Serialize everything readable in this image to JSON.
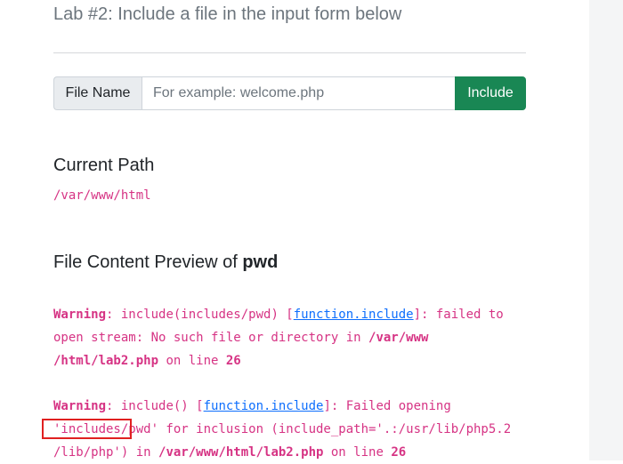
{
  "page": {
    "title": "Lab #2: Include a file in the input form below"
  },
  "form": {
    "addon_label": "File Name",
    "placeholder": "For example: welcome.php",
    "value": "",
    "button_label": "Include"
  },
  "current_path": {
    "heading": "Current Path",
    "value": "/var/www/html"
  },
  "preview": {
    "heading_prefix": "File Content Preview of ",
    "filename": "pwd"
  },
  "warning1": {
    "label": "Warning",
    "text_a": ": include(includes/pwd) [",
    "link": "function.include",
    "text_b": "]: failed to",
    "line2_a": "open stream: No such file or directory in ",
    "path1": "/var/www",
    "path2": "/html/lab2.php",
    "on_line": " on line ",
    "line_no": "26"
  },
  "warning2": {
    "label": "Warning",
    "text_a": ": include() [",
    "link": "function.include",
    "text_b": "]: Failed opening",
    "line2": "'includes/pwd' for inclusion (include_path='.:/usr/lib/php5.2",
    "line3_a": "/lib/php') in ",
    "path": "/var/www/html/lab2.php",
    "on_line": " on line ",
    "line_no": "26"
  }
}
